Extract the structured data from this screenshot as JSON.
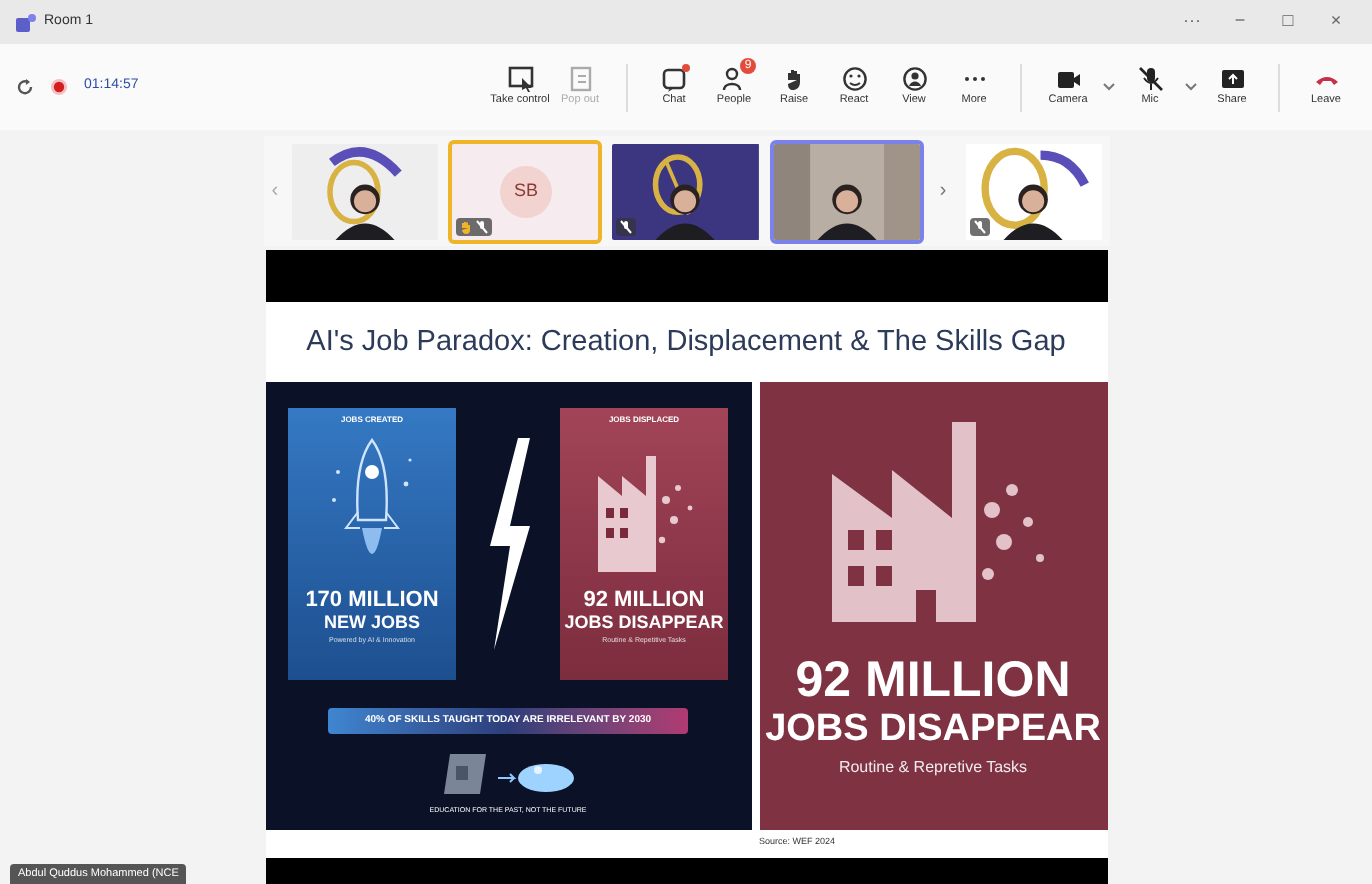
{
  "window": {
    "title": "Room 1",
    "controls": [
      "···",
      "−",
      "□",
      "×"
    ]
  },
  "meeting": {
    "timer": "01:14:57",
    "recording": true
  },
  "toolbar": [
    {
      "kind": "take-control",
      "label": "Take control",
      "disabled": false
    },
    {
      "kind": "pop-out",
      "label": "Pop out",
      "disabled": true
    },
    {
      "kind": "chat",
      "label": "Chat",
      "disabled": false,
      "dot": true
    },
    {
      "kind": "people",
      "label": "People",
      "disabled": false,
      "badge": "9"
    },
    {
      "kind": "raise",
      "label": "Raise",
      "disabled": false
    },
    {
      "kind": "react",
      "label": "React",
      "disabled": false
    },
    {
      "kind": "view",
      "label": "View",
      "disabled": false
    },
    {
      "kind": "more",
      "label": "More",
      "disabled": false
    },
    {
      "kind": "camera",
      "label": "Camera",
      "disabled": false,
      "caret": true
    },
    {
      "kind": "mic",
      "label": "Mic",
      "disabled": false,
      "caret": true
    },
    {
      "kind": "share",
      "label": "Share",
      "disabled": false
    },
    {
      "kind": "leave",
      "label": "Leave",
      "disabled": false
    }
  ],
  "gallery": {
    "prev_arrow": "‹",
    "next_arrow": "›",
    "tiles": [
      {
        "kind": "video",
        "speaking": false,
        "selected": false,
        "hand_raised": false,
        "muted": false
      },
      {
        "kind": "avatar",
        "initials": "SB",
        "speaking": true,
        "selected": false,
        "hand_raised": true,
        "muted": true
      },
      {
        "kind": "video",
        "speaking": false,
        "selected": false,
        "hand_raised": false,
        "muted": true
      },
      {
        "kind": "video",
        "speaking": false,
        "selected": true,
        "hand_raised": false,
        "muted": false
      }
    ],
    "tiles_after_arrow": [
      {
        "kind": "video",
        "speaking": false,
        "selected": false,
        "hand_raised": false,
        "muted": true
      }
    ]
  },
  "slide": {
    "title": "AI's Job Paradox: Creation, Displacement & The Skills Gap",
    "infographic": {
      "created": {
        "heading": "JOBS CREATED",
        "figure": "170 MILLION",
        "subject": "NEW JOBS",
        "note": "Powered by AI & Innovation"
      },
      "displaced": {
        "heading": "JOBS DISPLACED",
        "figure": "92 MILLION",
        "subject": "JOBS DISAPPEAR",
        "note": "Routine & Repetitive Tasks"
      },
      "banner": "40% OF SKILLS TAUGHT TODAY ARE IRRELEVANT BY 2030",
      "footer": "EDUCATION FOR THE PAST, NOT THE FUTURE"
    },
    "poster": {
      "figure": "92 MILLION",
      "subject": "JOBS DISAPPEAR",
      "note": "Routine & Repretive Tasks"
    },
    "source": "Source: WEF 2024"
  },
  "presenter": "Abdul Quddus Mohammed (NCE"
}
